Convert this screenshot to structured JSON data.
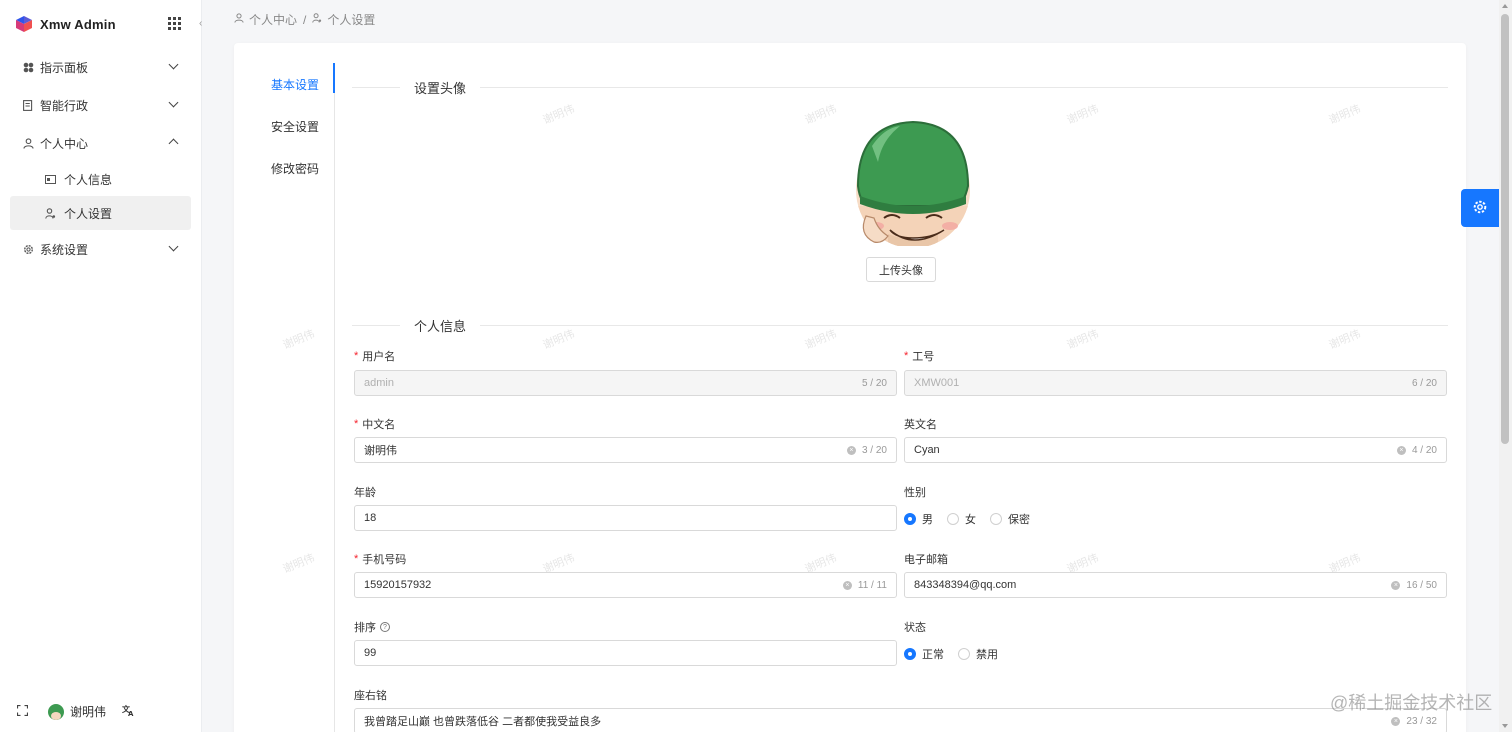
{
  "app": {
    "title": "Xmw Admin"
  },
  "sidebar": {
    "items": [
      {
        "label": "指示面板",
        "icon": "dashboard-icon",
        "expanded": false
      },
      {
        "label": "智能行政",
        "icon": "document-icon",
        "expanded": false
      },
      {
        "label": "个人中心",
        "icon": "user-icon",
        "expanded": true
      },
      {
        "label": "系统设置",
        "icon": "gear-icon",
        "expanded": false
      }
    ],
    "sub_items": [
      {
        "label": "个人信息",
        "icon": "id-card-icon"
      },
      {
        "label": "个人设置",
        "icon": "user-settings-icon",
        "active": true
      }
    ],
    "footer": {
      "user": "谢明伟"
    }
  },
  "breadcrumb": {
    "items": [
      "个人中心",
      "个人设置"
    ],
    "separator": "/"
  },
  "tabs": [
    {
      "label": "基本设置",
      "active": true
    },
    {
      "label": "安全设置"
    },
    {
      "label": "修改密码"
    }
  ],
  "avatar_section": {
    "title": "设置头像",
    "upload_label": "上传头像"
  },
  "info_section": {
    "title": "个人信息"
  },
  "form": {
    "username": {
      "label": "用户名",
      "value": "admin",
      "count": "5 / 20"
    },
    "job_no": {
      "label": "工号",
      "value": "XMW001",
      "count": "6 / 20"
    },
    "cn_name": {
      "label": "中文名",
      "value": "谢明伟",
      "count": "3 / 20"
    },
    "en_name": {
      "label": "英文名",
      "value": "Cyan",
      "count": "4 / 20"
    },
    "age": {
      "label": "年龄",
      "value": "18"
    },
    "gender": {
      "label": "性别",
      "options": [
        "男",
        "女",
        "保密"
      ],
      "selected": "男"
    },
    "phone": {
      "label": "手机号码",
      "value": "15920157932",
      "count": "11 / 11"
    },
    "email": {
      "label": "电子邮箱",
      "value": "843348394@qq.com",
      "count": "16 / 50"
    },
    "sort": {
      "label": "排序",
      "value": "99"
    },
    "status": {
      "label": "状态",
      "options": [
        "正常",
        "禁用"
      ],
      "selected": "正常"
    },
    "motto": {
      "label": "座右铭",
      "value": "我曾踏足山巅 也曾跌落低谷 二者都使我受益良多",
      "count": "23 / 32"
    }
  },
  "watermark_text": "谢明伟",
  "site_watermark": "@稀土掘金技术社区",
  "colors": {
    "primary": "#1677ff",
    "required": "#f5222d",
    "helmet": "#3d9a51"
  }
}
